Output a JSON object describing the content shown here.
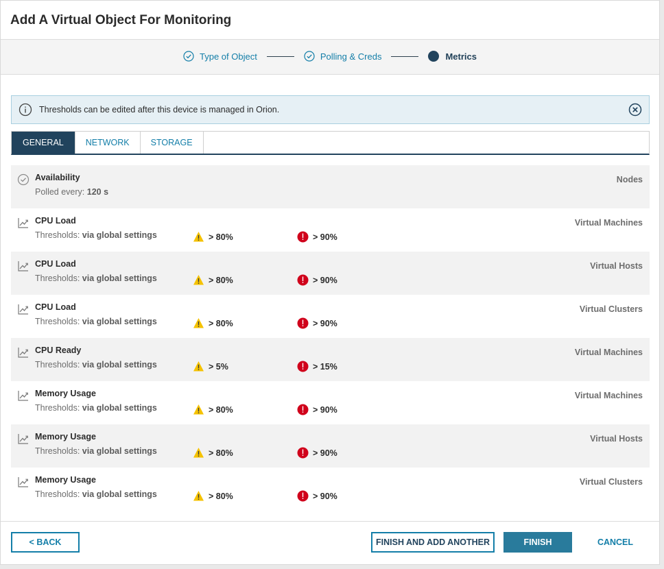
{
  "dialog": {
    "title": "Add A Virtual Object For Monitoring"
  },
  "stepper": {
    "steps": [
      {
        "label": "Type of Object",
        "state": "done",
        "icon": "check-circle-icon"
      },
      {
        "label": "Polling & Creds",
        "state": "done",
        "icon": "check-circle-icon"
      },
      {
        "label": "Metrics",
        "state": "current",
        "icon": "filled-circle-icon"
      }
    ]
  },
  "alert": {
    "text": "Thresholds can be edited after this device is managed in Orion.",
    "icon": "info-icon",
    "close_icon": "close-circle-icon"
  },
  "tabs": [
    {
      "label": "GENERAL",
      "active": true
    },
    {
      "label": "NETWORK",
      "active": false
    },
    {
      "label": "STORAGE",
      "active": false
    }
  ],
  "metrics": [
    {
      "name": "Availability",
      "sub_label": "Polled every:",
      "sub_value": "120 s",
      "scope": "Nodes",
      "icon": "check-circle-icon"
    },
    {
      "name": "CPU Load",
      "sub_label": "Thresholds:",
      "sub_value": "via global settings",
      "warning": "> 80%",
      "critical": "> 90%",
      "scope": "Virtual Machines",
      "icon": "trend-chart-icon"
    },
    {
      "name": "CPU Load",
      "sub_label": "Thresholds:",
      "sub_value": "via global settings",
      "warning": "> 80%",
      "critical": "> 90%",
      "scope": "Virtual Hosts",
      "icon": "trend-chart-icon"
    },
    {
      "name": "CPU Load",
      "sub_label": "Thresholds:",
      "sub_value": "via global settings",
      "warning": "> 80%",
      "critical": "> 90%",
      "scope": "Virtual Clusters",
      "icon": "trend-chart-icon"
    },
    {
      "name": "CPU Ready",
      "sub_label": "Thresholds:",
      "sub_value": "via global settings",
      "warning": "> 5%",
      "critical": "> 15%",
      "scope": "Virtual Machines",
      "icon": "trend-chart-icon"
    },
    {
      "name": "Memory Usage",
      "sub_label": "Thresholds:",
      "sub_value": "via global settings",
      "warning": "> 80%",
      "critical": "> 90%",
      "scope": "Virtual Machines",
      "icon": "trend-chart-icon"
    },
    {
      "name": "Memory Usage",
      "sub_label": "Thresholds:",
      "sub_value": "via global settings",
      "warning": "> 80%",
      "critical": "> 90%",
      "scope": "Virtual Hosts",
      "icon": "trend-chart-icon"
    },
    {
      "name": "Memory Usage",
      "sub_label": "Thresholds:",
      "sub_value": "via global settings",
      "warning": "> 80%",
      "critical": "> 90%",
      "scope": "Virtual Clusters",
      "icon": "trend-chart-icon"
    }
  ],
  "footer": {
    "back_label": "< BACK",
    "finish_another_label": "FINISH AND ADD ANOTHER",
    "finish_label": "FINISH",
    "cancel_label": "CANCEL"
  },
  "colors": {
    "accent": "#137ea8",
    "navy": "#21435d",
    "warning": "#f5c200",
    "critical": "#d0021b"
  }
}
